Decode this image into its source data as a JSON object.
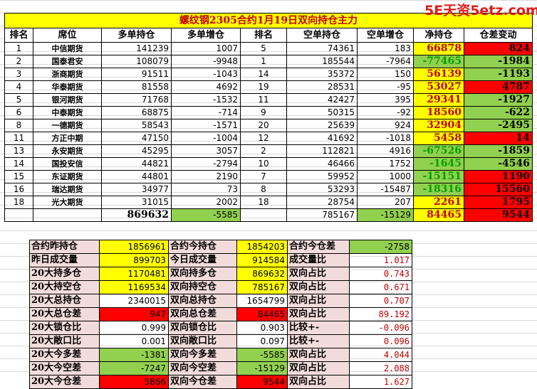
{
  "watermark": "5E天资5etz.com",
  "title": "螺纹钢2305合约1月19日双向持仓主力",
  "headers": [
    "排名",
    "席位",
    "多单持仓",
    "多单增仓",
    "排名",
    "空单持仓",
    "空单增仓",
    "净持仓",
    "仓差变动"
  ],
  "rows": [
    {
      "rank": "1",
      "seat": "中信期货",
      "long": "141239",
      "long_chg": "1007",
      "srank": "5",
      "short": "74361",
      "short_chg": "183",
      "net": "66878",
      "diff": "824"
    },
    {
      "rank": "2",
      "seat": "国泰君安",
      "long": "108079",
      "long_chg": "-9948",
      "srank": "1",
      "short": "185544",
      "short_chg": "-7964",
      "net": "-77465",
      "diff": "-1984"
    },
    {
      "rank": "3",
      "seat": "浙商期货",
      "long": "91511",
      "long_chg": "-1043",
      "srank": "14",
      "short": "35372",
      "short_chg": "150",
      "net": "56139",
      "diff": "-1193"
    },
    {
      "rank": "4",
      "seat": "华泰期货",
      "long": "81558",
      "long_chg": "4692",
      "srank": "19",
      "short": "28531",
      "short_chg": "-95",
      "net": "53027",
      "diff": "4787"
    },
    {
      "rank": "5",
      "seat": "银河期货",
      "long": "71768",
      "long_chg": "-1532",
      "srank": "11",
      "short": "42427",
      "short_chg": "395",
      "net": "29341",
      "diff": "-1927"
    },
    {
      "rank": "6",
      "seat": "中泰期货",
      "long": "68875",
      "long_chg": "-714",
      "srank": "9",
      "short": "50315",
      "short_chg": "-92",
      "net": "18560",
      "diff": "-622"
    },
    {
      "rank": "8",
      "seat": "一德期货",
      "long": "58543",
      "long_chg": "-1571",
      "srank": "20",
      "short": "25639",
      "short_chg": "924",
      "net": "32904",
      "diff": "-2495"
    },
    {
      "rank": "11",
      "seat": "方正中期",
      "long": "47150",
      "long_chg": "-1004",
      "srank": "12",
      "short": "41692",
      "short_chg": "-1018",
      "net": "5458",
      "diff": "14"
    },
    {
      "rank": "13",
      "seat": "永安期货",
      "long": "45295",
      "long_chg": "3057",
      "srank": "2",
      "short": "112821",
      "short_chg": "4916",
      "net": "-67526",
      "diff": "-1859"
    },
    {
      "rank": "14",
      "seat": "国投安信",
      "long": "44821",
      "long_chg": "-2794",
      "srank": "10",
      "short": "46466",
      "short_chg": "1752",
      "net": "-1645",
      "diff": "-4546"
    },
    {
      "rank": "15",
      "seat": "东证期货",
      "long": "44801",
      "long_chg": "2190",
      "srank": "7",
      "short": "59952",
      "short_chg": "1000",
      "net": "-15151",
      "diff": "1190"
    },
    {
      "rank": "16",
      "seat": "瑞达期货",
      "long": "34977",
      "long_chg": "73",
      "srank": "8",
      "short": "53293",
      "short_chg": "-15487",
      "net": "-18316",
      "diff": "15560"
    },
    {
      "rank": "18",
      "seat": "光大期货",
      "long": "31015",
      "long_chg": "2002",
      "srank": "18",
      "short": "28754",
      "short_chg": "207",
      "net": "2261",
      "diff": "1795"
    }
  ],
  "totals": {
    "long": "869632",
    "long_chg": "-5585",
    "short": "785167",
    "short_chg": "-15129",
    "net": "84465",
    "diff": "9544"
  },
  "stats": [
    {
      "l1": "合约昨持仓",
      "v1": "1856961",
      "l2": "合约今持仓",
      "v2": "1854203",
      "l3": "合约今仓差",
      "v3": "-2758"
    },
    {
      "l1": "昨日成交量",
      "v1": "899703",
      "l2": "今日成交量",
      "v2": "914584",
      "l3": "成交量比",
      "v3": "1.017"
    },
    {
      "l1": "20大持多仓",
      "v1": "1170481",
      "l2": "双向持多仓",
      "v2": "869632",
      "l3": "双向占比",
      "v3": "0.743"
    },
    {
      "l1": "20大持空仓",
      "v1": "1169534",
      "l2": "双向持空仓",
      "v2": "785167",
      "l3": "双向占比",
      "v3": "0.671"
    },
    {
      "l1": "20大总持仓",
      "v1": "2340015",
      "l2": "双向总持仓",
      "v2": "1654799",
      "l3": "双向占比",
      "v3": "0.707"
    },
    {
      "l1": "20大总仓差",
      "v1": "947",
      "l2": "双向总仓差",
      "v2": "84465",
      "l3": "双向占比",
      "v3": "89.192"
    },
    {
      "l1": "20大锁仓比",
      "v1": "0.999",
      "l2": "双向锁仓比",
      "v2": "0.903",
      "l3": "比较+-",
      "v3": "-0.096"
    },
    {
      "l1": "20大敞口比",
      "v1": "0.001",
      "l2": "双向敞口比",
      "v2": "0.097",
      "l3": "比较+-",
      "v3": "0.096"
    },
    {
      "l1": "20大今多差",
      "v1": "-1381",
      "l2": "双向今多差",
      "v2": "-5585",
      "l3": "双向占比",
      "v3": "4.044"
    },
    {
      "l1": "20大今空差",
      "v1": "-7247",
      "l2": "双向今空差",
      "v2": "-15129",
      "l3": "双向占比",
      "v3": "2.088"
    },
    {
      "l1": "20大今仓差",
      "v1": "5866",
      "l2": "双向今仓差",
      "v2": "9544",
      "l3": "双向占比",
      "v3": "1.627"
    }
  ],
  "colors": {
    "yellow": "#ffff00",
    "red": "#ff0000",
    "green": "#92d050",
    "pink": "#f2dcdb",
    "title_text": "#c00000",
    "watermark": "#e21b1b"
  }
}
